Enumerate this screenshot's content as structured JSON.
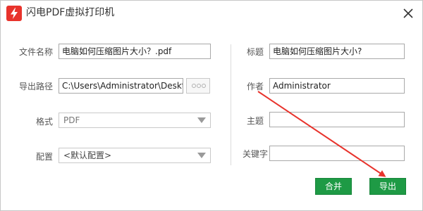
{
  "window": {
    "title": "闪电PDF虚拟打印机"
  },
  "left": {
    "filename_label": "文件名称",
    "filename_value": "电脑如何压缩图片大小？.pdf",
    "exportpath_label": "导出路径",
    "exportpath_value": "C:\\Users\\Administrator\\Desktop",
    "format_label": "格式",
    "format_value": "PDF",
    "config_label": "配置",
    "config_value": "<默认配置>"
  },
  "right": {
    "title_label": "标题",
    "title_value": "电脑如何压缩图片大小?",
    "author_label": "作者",
    "author_value": "Administrator",
    "subject_label": "主题",
    "subject_value": "",
    "keywords_label": "关键字",
    "keywords_value": ""
  },
  "buttons": {
    "merge": "合并",
    "export": "导出"
  },
  "colors": {
    "button_green": "#1e9a45",
    "annotation_arrow": "#e8332c",
    "logo_red": "#e8332c"
  },
  "icons": {
    "logo": "lightning-pdf-logo",
    "close": "close-icon",
    "browse": "ellipsis-icon",
    "dropdown": "chevron-down-icon"
  }
}
